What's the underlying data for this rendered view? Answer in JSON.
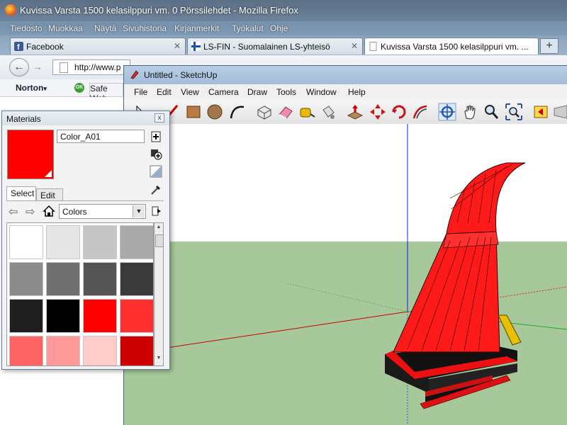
{
  "firefox": {
    "title": "Kuvissa Varsta 1500 kelasilppuri vm. 0 Pörssilehdet - Mozilla Firefox",
    "menu": [
      "Tiedosto",
      "Muokkaa",
      "Näytä",
      "Sivuhistoria",
      "Kirjanmerkit",
      "Työkalut",
      "Ohje"
    ],
    "tabs": [
      {
        "label": "Facebook",
        "active": false
      },
      {
        "label": "LS-FIN - Suomalainen LS-yhteisö",
        "active": false
      },
      {
        "label": "Kuvissa Varsta 1500 kelasilppuri vm. ...",
        "active": true
      }
    ],
    "new_tab": "+",
    "url": "http://www.p",
    "norton": "Norton",
    "norton_caret": "▾",
    "safe_web_badge": "OK",
    "safe_web": "Safe Web"
  },
  "sketchup": {
    "title": "Untitled - SketchUp",
    "menu": [
      "File",
      "Edit",
      "View",
      "Camera",
      "Draw",
      "Tools",
      "Window",
      "Help"
    ],
    "tools": [
      "select",
      "line",
      "rectangle",
      "circle",
      "arc",
      "make-component",
      "eraser",
      "tape-measure",
      "paint-bucket",
      "push-pull",
      "move",
      "rotate",
      "offset",
      "orbit",
      "pan",
      "zoom",
      "zoom-extents",
      "previous-view",
      "next-view"
    ],
    "colors": {
      "sky": "#ffffff",
      "ground": "#a6c89a",
      "model_red": "#ff1a1a",
      "model_dark": "#1a1a1a"
    }
  },
  "materials": {
    "title": "Materials",
    "close": "x",
    "current_name": "Color_A01",
    "current_color": "#ff0000",
    "tabs": [
      "Select",
      "Edit"
    ],
    "library": "Colors",
    "swatches": [
      "#ffffff",
      "#e6e6e6",
      "#c6c6c6",
      "#aaaaaa",
      "#8c8c8c",
      "#707070",
      "#555555",
      "#3a3a3a",
      "#1e1e1e",
      "#000000",
      "#ff0000",
      "#ff3030",
      "#ff6464",
      "#ff9a9a",
      "#ffcccc",
      "#cc0000"
    ]
  }
}
